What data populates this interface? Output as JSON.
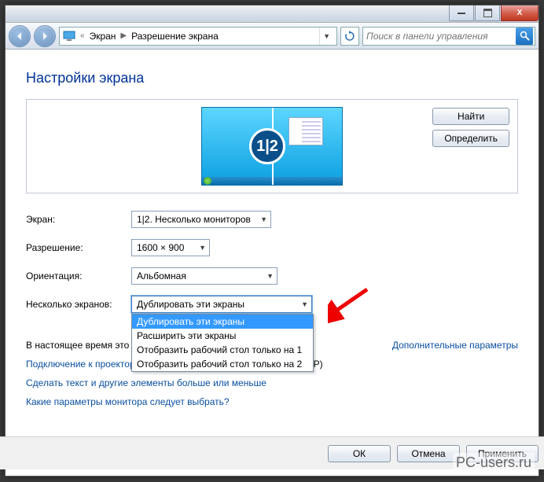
{
  "titlebar": {
    "min": "min",
    "max": "max",
    "close": "X"
  },
  "breadcrumb": {
    "level1": "Экран",
    "level2": "Разрешение экрана"
  },
  "search": {
    "placeholder": "Поиск в панели управления"
  },
  "heading": "Настройки экрана",
  "preview": {
    "badge": "1|2"
  },
  "side": {
    "find": "Найти",
    "detect": "Определить"
  },
  "form": {
    "display_label": "Экран:",
    "display_value": "1|2. Несколько мониторов",
    "resolution_label": "Разрешение:",
    "resolution_value": "1600 × 900",
    "orientation_label": "Ориентация:",
    "orientation_value": "Альбомная",
    "multi_label": "Несколько экранов:",
    "multi_value": "Дублировать эти экраны",
    "multi_options": [
      "Дублировать эти экраны",
      "Расширить эти экраны",
      "Отобразить рабочий стол только на 1",
      "Отобразить рабочий стол только на 2"
    ]
  },
  "status": {
    "prefix": "В настоящее время это основной экран."
  },
  "links": {
    "advanced": "Дополнительные параметры",
    "projector_a": "Подключение к проектору",
    "projector_b": " (или нажмите клавишу 🪟 и коснитесь P)",
    "textsize": "Сделать текст и другие элементы больше или меньше",
    "whichparams": "Какие параметры монитора следует выбрать?"
  },
  "buttons": {
    "ok": "ОК",
    "cancel": "Отмена",
    "apply": "Применить"
  },
  "watermark": "PC-users.ru"
}
